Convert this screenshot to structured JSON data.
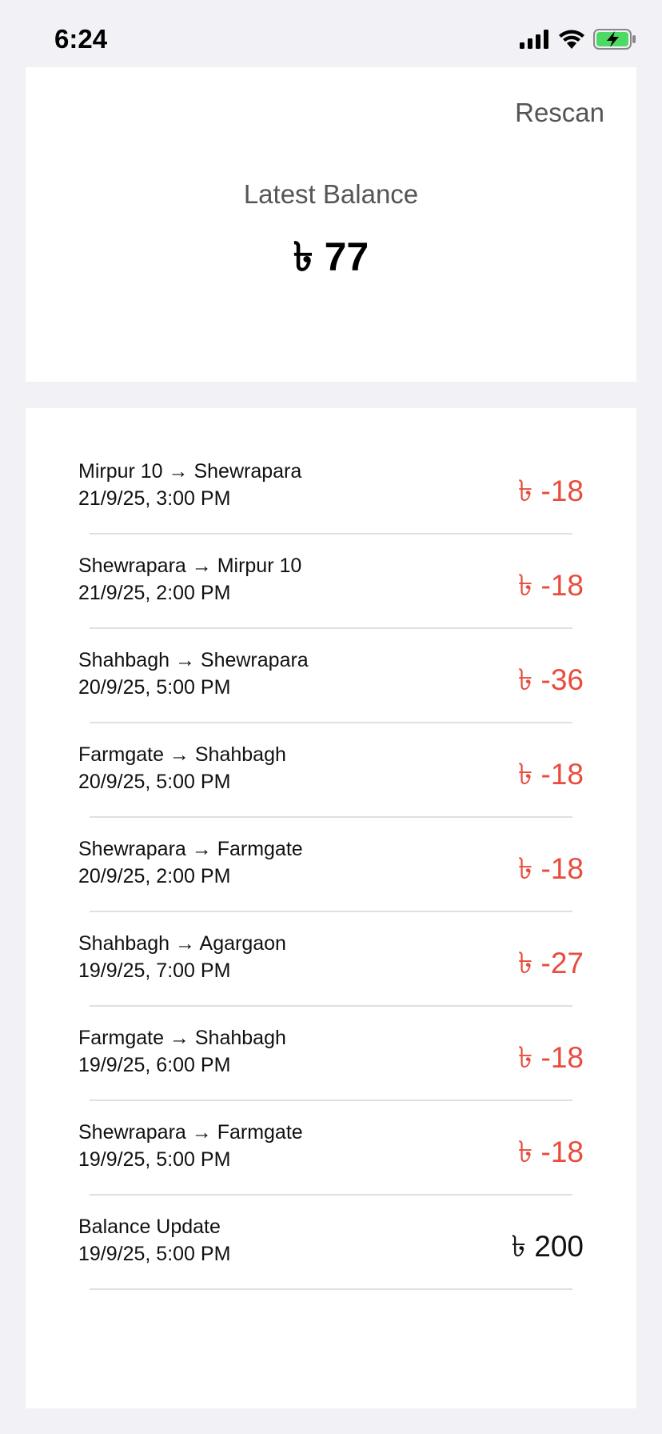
{
  "status_bar": {
    "time": "6:24",
    "icons": [
      "signal-icon",
      "wifi-icon",
      "battery-charging-icon"
    ],
    "battery_color": "#4cd964"
  },
  "header": {
    "rescan_label": "Rescan",
    "balance_label": "Latest Balance",
    "balance_value": "৳ 77"
  },
  "colors": {
    "debit": "#e84c3d",
    "credit": "#111111",
    "background": "#f1f1f6"
  },
  "transactions": [
    {
      "title": "Mirpur 10 → Shewrapara",
      "date": "21/9/25, 3:00 PM",
      "amount": "৳ -18",
      "type": "debit"
    },
    {
      "title": "Shewrapara → Mirpur 10",
      "date": "21/9/25, 2:00 PM",
      "amount": "৳ -18",
      "type": "debit"
    },
    {
      "title": "Shahbagh → Shewrapara",
      "date": "20/9/25, 5:00 PM",
      "amount": "৳ -36",
      "type": "debit"
    },
    {
      "title": "Farmgate → Shahbagh",
      "date": "20/9/25, 5:00 PM",
      "amount": "৳ -18",
      "type": "debit"
    },
    {
      "title": "Shewrapara → Farmgate",
      "date": "20/9/25, 2:00 PM",
      "amount": "৳ -18",
      "type": "debit"
    },
    {
      "title": "Shahbagh → Agargaon",
      "date": "19/9/25, 7:00 PM",
      "amount": "৳ -27",
      "type": "debit"
    },
    {
      "title": "Farmgate → Shahbagh",
      "date": "19/9/25, 6:00 PM",
      "amount": "৳ -18",
      "type": "debit"
    },
    {
      "title": "Shewrapara → Farmgate",
      "date": "19/9/25, 5:00 PM",
      "amount": "৳ -18",
      "type": "debit"
    },
    {
      "title": "Balance Update",
      "date": "19/9/25, 5:00 PM",
      "amount": "৳ 200",
      "type": "credit"
    }
  ]
}
